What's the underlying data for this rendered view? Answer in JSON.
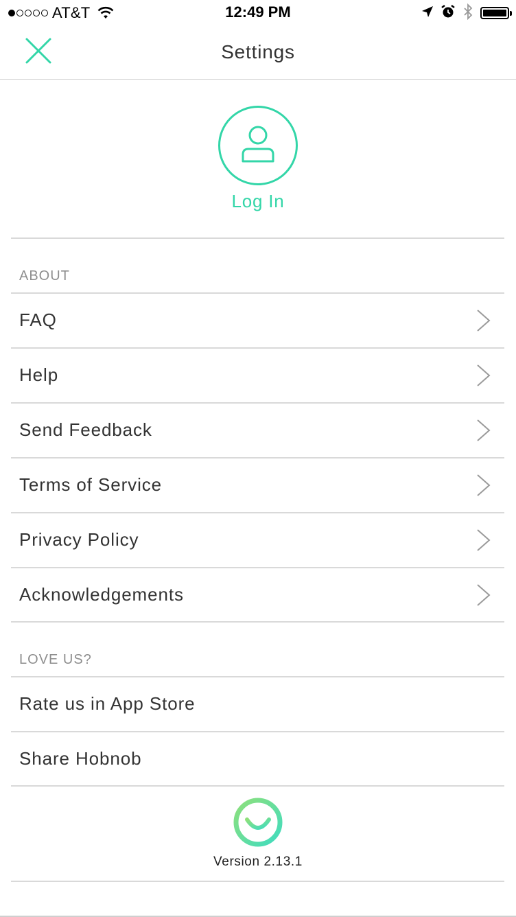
{
  "status_bar": {
    "carrier": "AT&T",
    "time": "12:49 PM",
    "signal_bars": 1,
    "signal_total": 5,
    "battery_level": 1.0
  },
  "nav": {
    "title": "Settings",
    "close_icon": "close-x-icon"
  },
  "login": {
    "label": "Log In",
    "icon": "user-icon"
  },
  "sections": {
    "about": {
      "header": "ABOUT",
      "items": [
        {
          "label": "FAQ"
        },
        {
          "label": "Help"
        },
        {
          "label": "Send Feedback"
        },
        {
          "label": "Terms of Service"
        },
        {
          "label": "Privacy Policy"
        },
        {
          "label": "Acknowledgements"
        }
      ]
    },
    "love_us": {
      "header": "LOVE US?",
      "items": [
        {
          "label": "Rate us in App Store"
        },
        {
          "label": "Share Hobnob"
        }
      ]
    }
  },
  "footer": {
    "version": "Version 2.13.1",
    "logo_icon": "hobnob-smile-logo"
  },
  "colors": {
    "accent": "#33d6a8",
    "text": "#333333",
    "muted": "#8e8e8e",
    "divider": "#d9d9d9"
  }
}
